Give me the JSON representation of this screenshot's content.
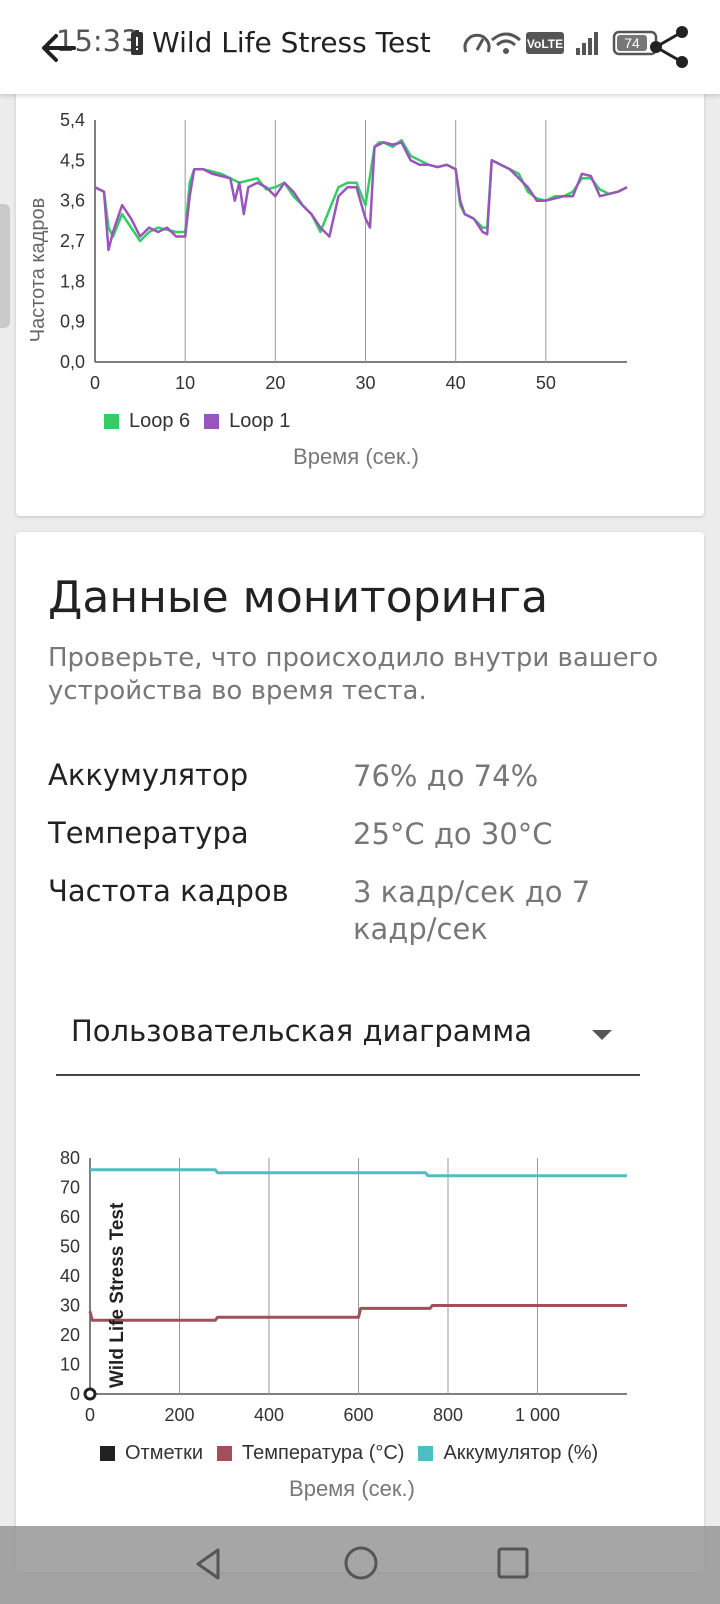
{
  "status_bar": {
    "time": "15:33",
    "battery": "74"
  },
  "app_bar": {
    "title": "Wild Life Stress Test"
  },
  "fps_chart": {
    "ylabel": "Частота кадров",
    "xtitle": "Время (сек.)",
    "y_ticks": [
      "0,0",
      "0,9",
      "1,8",
      "2,7",
      "3,6",
      "4,5",
      "5,4"
    ],
    "x_ticks": [
      "0",
      "10",
      "20",
      "30",
      "40",
      "50"
    ],
    "legend": [
      {
        "label": "Loop 6",
        "color": "#33cc66"
      },
      {
        "label": "Loop 1",
        "color": "#9955bb"
      }
    ]
  },
  "monitoring": {
    "title": "Данные мониторинга",
    "subtitle": "Проверьте, что происходило внутри вашего устройства во время теста.",
    "rows": [
      {
        "key": "Аккумулятор",
        "value": "76% до 74%"
      },
      {
        "key": "Температура",
        "value": "25°C до 30°C"
      },
      {
        "key": "Частота кадров",
        "value": "3 кадр/сек до 7 кадр/сек"
      }
    ],
    "dropdown": {
      "selected": "Пользовательская диаграмма"
    }
  },
  "custom_chart": {
    "series_label_vertical": "Wild Life Stress Test",
    "xtitle": "Время (сек.)",
    "y_ticks": [
      "0",
      "10",
      "20",
      "30",
      "40",
      "50",
      "60",
      "70",
      "80"
    ],
    "x_ticks": [
      "0",
      "200",
      "400",
      "600",
      "800",
      "1 000"
    ],
    "legend": [
      {
        "label": "Отметки",
        "color": "#222222"
      },
      {
        "label": "Температура (°C)",
        "color": "#a0505a"
      },
      {
        "label": "Аккумулятор (%)",
        "color": "#4dbfc2"
      }
    ]
  },
  "chart_data": [
    {
      "type": "line",
      "xlabel": "Время (сек.)",
      "ylabel": "Частота кадров",
      "xlim": [
        0,
        59
      ],
      "ylim": [
        0,
        5.4
      ],
      "series": [
        {
          "name": "Loop 6",
          "color": "#33cc66",
          "x": [
            0,
            1,
            1.5,
            2,
            3,
            4,
            5,
            6,
            7,
            8,
            9,
            10,
            10.5,
            11,
            12,
            13,
            14,
            15,
            16,
            17,
            18,
            19,
            20,
            21,
            22,
            23,
            24,
            25,
            26,
            27,
            28,
            29,
            30,
            31,
            31.5,
            32,
            33,
            34,
            35,
            36,
            37,
            38,
            39,
            40,
            40.5,
            41,
            42,
            43,
            43.5,
            44,
            45,
            46,
            47,
            48,
            49,
            50,
            51,
            52,
            53,
            54,
            55,
            56,
            57,
            58,
            59
          ],
          "y": [
            3.9,
            3.8,
            3.0,
            2.8,
            3.3,
            3.0,
            2.7,
            2.9,
            3.0,
            2.95,
            2.9,
            2.9,
            4.0,
            4.3,
            4.3,
            4.25,
            4.2,
            4.1,
            4.0,
            4.05,
            4.1,
            3.85,
            3.9,
            4.0,
            3.7,
            3.5,
            3.3,
            2.9,
            3.4,
            3.9,
            4.0,
            4.0,
            3.5,
            4.8,
            4.9,
            4.9,
            4.8,
            4.95,
            4.6,
            4.5,
            4.4,
            4.35,
            4.4,
            4.3,
            3.5,
            3.3,
            3.2,
            3.0,
            3.0,
            4.5,
            4.4,
            4.3,
            4.2,
            3.8,
            3.65,
            3.6,
            3.7,
            3.7,
            3.8,
            4.1,
            4.1,
            3.85,
            3.75,
            3.8,
            3.9
          ]
        },
        {
          "name": "Loop 1",
          "color": "#9955bb",
          "x": [
            0,
            1,
            1.5,
            2,
            3,
            4,
            5,
            6,
            7,
            8,
            9,
            10,
            10.5,
            11,
            12,
            13,
            14,
            15,
            15.5,
            16,
            16.5,
            17,
            18,
            19,
            20,
            21,
            22,
            23,
            24,
            25,
            26,
            27,
            28,
            29,
            30,
            30.5,
            31,
            32,
            33,
            34,
            35,
            36,
            37,
            38,
            39,
            40,
            40.5,
            41,
            42,
            43,
            43.5,
            44,
            45,
            46,
            47,
            48,
            49,
            50,
            51,
            52,
            53,
            54,
            55,
            56,
            57,
            58,
            59
          ],
          "y": [
            3.9,
            3.8,
            2.5,
            2.9,
            3.5,
            3.2,
            2.8,
            3.0,
            2.9,
            3.0,
            2.8,
            2.8,
            3.7,
            4.3,
            4.3,
            4.2,
            4.15,
            4.1,
            3.6,
            4.0,
            3.3,
            3.9,
            4.0,
            3.9,
            3.7,
            4.0,
            3.8,
            3.5,
            3.3,
            3.0,
            2.8,
            3.7,
            3.9,
            3.9,
            3.2,
            3.0,
            4.8,
            4.9,
            4.85,
            4.9,
            4.5,
            4.4,
            4.4,
            4.35,
            4.4,
            4.3,
            3.6,
            3.3,
            3.2,
            2.9,
            2.85,
            4.5,
            4.4,
            4.3,
            4.1,
            3.9,
            3.6,
            3.6,
            3.65,
            3.7,
            3.7,
            4.2,
            4.15,
            3.7,
            3.75,
            3.8,
            3.9
          ]
        }
      ]
    },
    {
      "type": "line",
      "xlabel": "Время (сек.)",
      "xlim": [
        0,
        1200
      ],
      "ylim": [
        0,
        80
      ],
      "series": [
        {
          "name": "Температура (°C)",
          "color": "#a0505a",
          "x": [
            0,
            5,
            280,
            285,
            600,
            605,
            760,
            765,
            1200
          ],
          "y": [
            28,
            25,
            25,
            26,
            26,
            29,
            29,
            30,
            30
          ]
        },
        {
          "name": "Аккумулятор (%)",
          "color": "#4dbfc2",
          "x": [
            0,
            280,
            285,
            750,
            755,
            1200
          ],
          "y": [
            76,
            76,
            75,
            75,
            74,
            74
          ]
        },
        {
          "name": "Отметки",
          "color": "#222222",
          "x": [
            0
          ],
          "y": [
            0
          ]
        }
      ]
    }
  ]
}
